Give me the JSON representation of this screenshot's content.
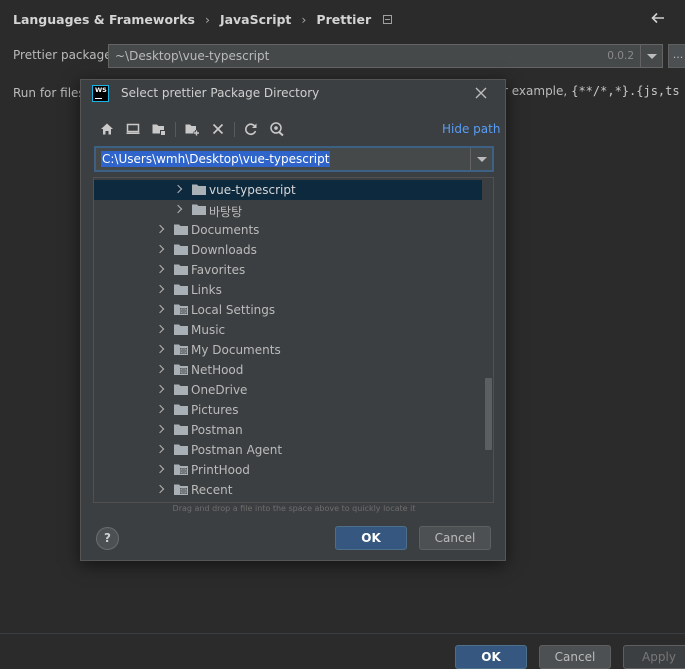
{
  "breadcrumb": {
    "items": [
      "Languages & Frameworks",
      "JavaScript",
      "Prettier"
    ],
    "separator": "›"
  },
  "settings": {
    "prettier_package_label": "Prettier package:",
    "prettier_package_value": "~\\Desktop\\vue-typescript",
    "prettier_package_version": "0.0.2",
    "browse_label": "...",
    "run_for_files_label": "Run for files:",
    "run_for_files_hint": "r example,",
    "run_for_files_glob": "{**/*,*}.{js,ts"
  },
  "footer": {
    "ok_label": "OK",
    "cancel_label": "Cancel",
    "apply_label": "Apply"
  },
  "dialog": {
    "logo_text": "WS",
    "title": "Select prettier Package Directory",
    "hide_path_label": "Hide path",
    "path_value": "C:\\Users\\wmh\\Desktop\\vue-typescript",
    "tree": [
      {
        "label": "vue-typescript",
        "level": 2,
        "selected": true,
        "special": false
      },
      {
        "label": "바탕탕",
        "level": 2,
        "selected": false,
        "special": false
      },
      {
        "label": "Documents",
        "level": 1,
        "selected": false,
        "special": false
      },
      {
        "label": "Downloads",
        "level": 1,
        "selected": false,
        "special": false
      },
      {
        "label": "Favorites",
        "level": 1,
        "selected": false,
        "special": false
      },
      {
        "label": "Links",
        "level": 1,
        "selected": false,
        "special": false
      },
      {
        "label": "Local Settings",
        "level": 1,
        "selected": false,
        "special": true
      },
      {
        "label": "Music",
        "level": 1,
        "selected": false,
        "special": false
      },
      {
        "label": "My Documents",
        "level": 1,
        "selected": false,
        "special": true
      },
      {
        "label": "NetHood",
        "level": 1,
        "selected": false,
        "special": true
      },
      {
        "label": "OneDrive",
        "level": 1,
        "selected": false,
        "special": false
      },
      {
        "label": "Pictures",
        "level": 1,
        "selected": false,
        "special": false
      },
      {
        "label": "Postman",
        "level": 1,
        "selected": false,
        "special": false
      },
      {
        "label": "Postman Agent",
        "level": 1,
        "selected": false,
        "special": false
      },
      {
        "label": "PrintHood",
        "level": 1,
        "selected": false,
        "special": true
      },
      {
        "label": "Recent",
        "level": 1,
        "selected": false,
        "special": true
      }
    ],
    "drag_hint": "Drag and drop a file into the space above to quickly locate it",
    "help_label": "?",
    "ok_label": "OK",
    "cancel_label": "Cancel"
  },
  "colors": {
    "background": "#2b2b2b",
    "dialog_background": "#3c3f41",
    "primary_button": "#365880",
    "link": "#589df6",
    "selection": "#2f65ca",
    "tree_selection": "#0d293e",
    "folder": "#a9b0b6"
  }
}
